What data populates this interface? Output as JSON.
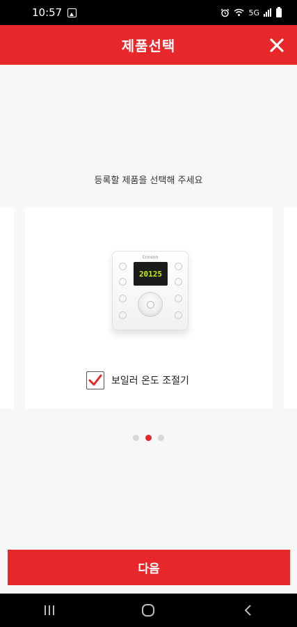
{
  "status_bar": {
    "time": "10:57",
    "icons": [
      "gallery-icon",
      "alarm-icon",
      "wifi-icon",
      "signal-icon",
      "battery-icon"
    ],
    "network_text": "5G"
  },
  "header": {
    "title": "제품선택",
    "background_color": "#e8272b",
    "close_icon": "close-icon"
  },
  "main": {
    "subtitle": "등록할 제품을 선택해 주세요",
    "carousel": {
      "selected_index": 1,
      "page_count": 3,
      "product": {
        "brand": "Cnnsnn",
        "display_reading": "20125",
        "label": "보일러 온도 조절기",
        "checked": true
      }
    }
  },
  "footer": {
    "next_label": "다음"
  },
  "nav_bar": {
    "buttons": [
      "recent-apps-icon",
      "home-icon",
      "back-icon"
    ]
  },
  "colors": {
    "accent": "#e8272b",
    "background": "#f7f7f7",
    "card": "#ffffff",
    "dot_inactive": "#d7d7d7"
  }
}
